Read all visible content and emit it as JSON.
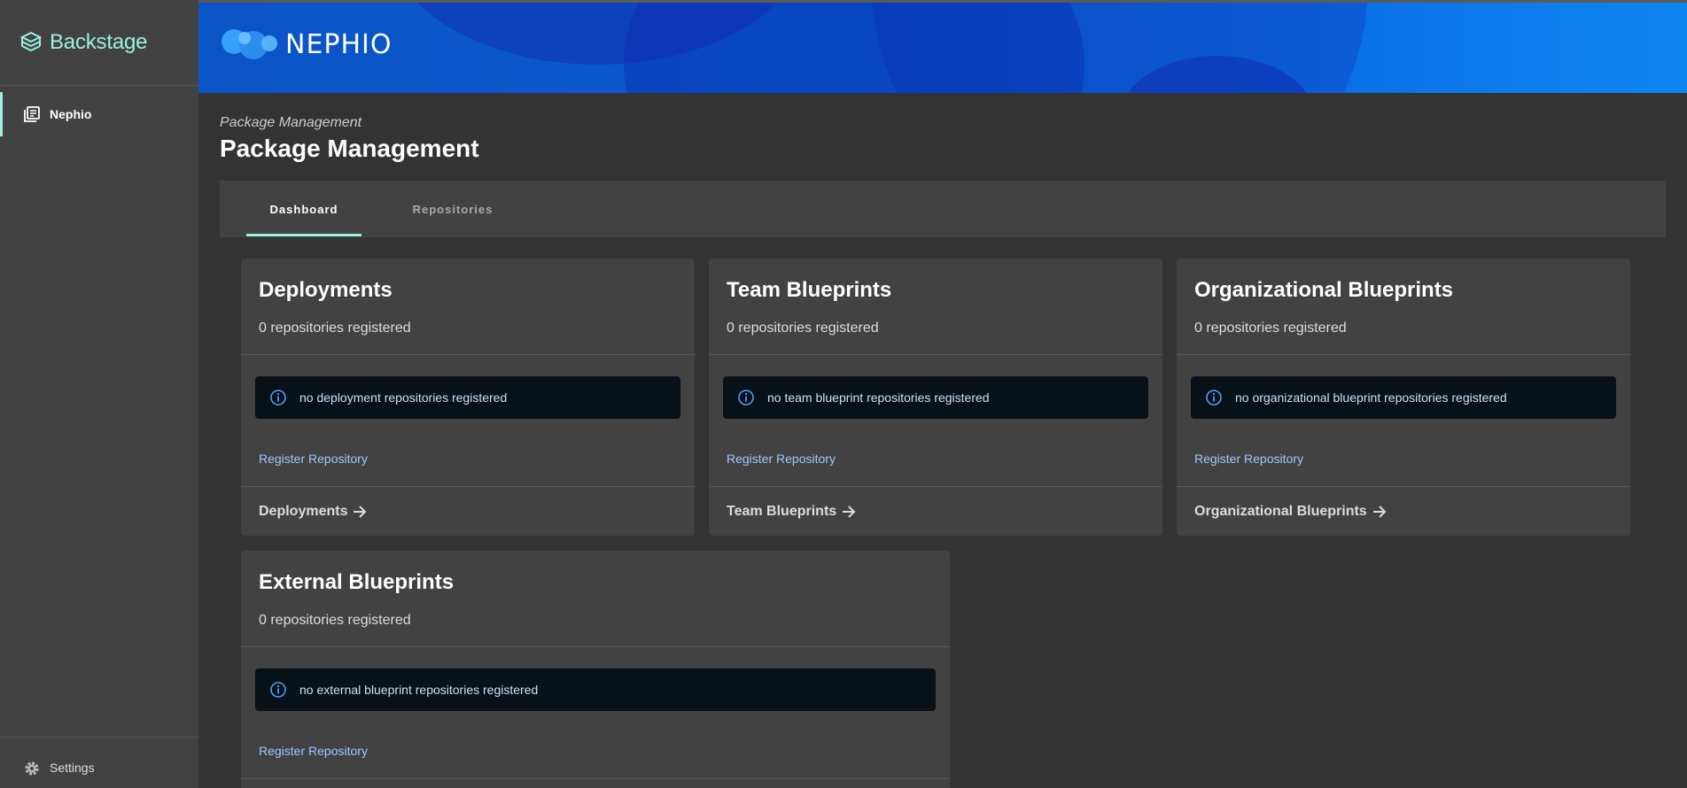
{
  "sidebar": {
    "brand": "Backstage",
    "nav_item": "Nephio",
    "settings": "Settings"
  },
  "banner": {
    "logo_text": "NEPHIO"
  },
  "header": {
    "subtitle": "Package Management",
    "title": "Package Management"
  },
  "tabs": [
    {
      "label": "Dashboard",
      "active": true
    },
    {
      "label": "Repositories",
      "active": false
    }
  ],
  "cards": [
    {
      "title": "Deployments",
      "count": "0 repositories registered",
      "alert": "no deployment repositories registered",
      "register": "Register Repository",
      "footer": "Deployments"
    },
    {
      "title": "Team Blueprints",
      "count": "0 repositories registered",
      "alert": "no team blueprint repositories registered",
      "register": "Register Repository",
      "footer": "Team Blueprints"
    },
    {
      "title": "Organizational Blueprints",
      "count": "0 repositories registered",
      "alert": "no organizational blueprint repositories registered",
      "register": "Register Repository",
      "footer": "Organizational Blueprints"
    },
    {
      "title": "External Blueprints",
      "count": "0 repositories registered",
      "alert": "no external blueprint repositories registered",
      "register": "Register Repository"
    }
  ],
  "colors": {
    "accent": "#9bf0e1",
    "link": "#9cc9ff",
    "banner_start": "#0a54c6",
    "banner_end": "#0d86f0",
    "alert_bg": "#081018"
  },
  "icons": {
    "brand": "backstage-logo-icon",
    "nav": "library-icon",
    "settings": "gear-icon",
    "alert": "info-icon",
    "footer": "arrow-right-icon"
  }
}
